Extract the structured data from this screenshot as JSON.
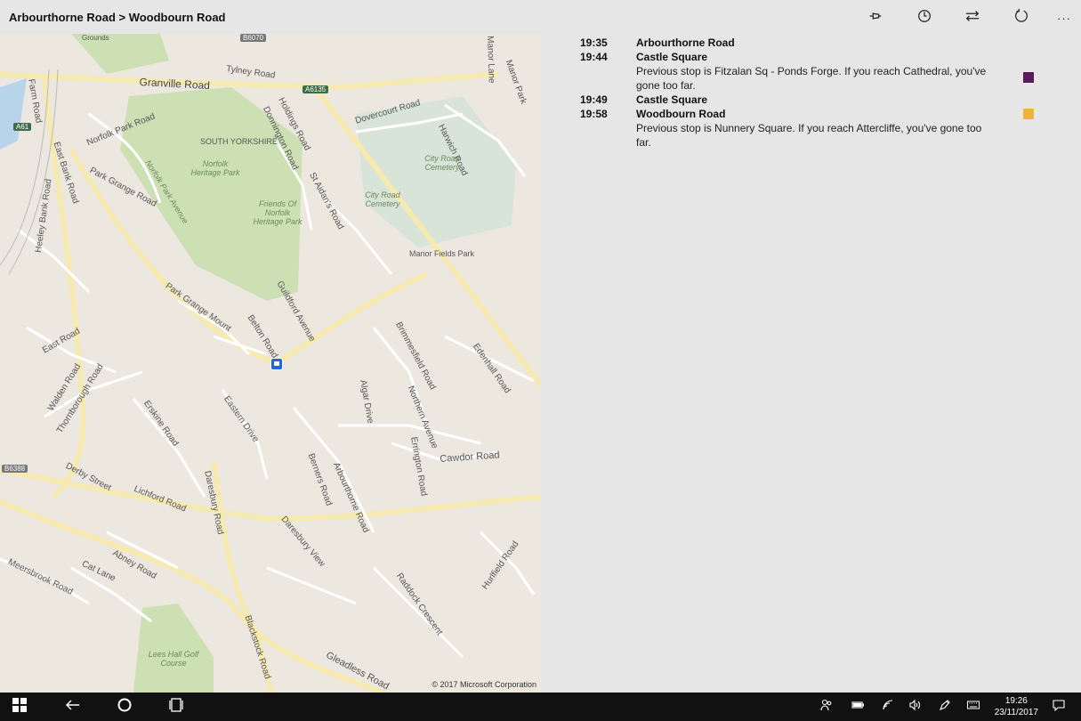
{
  "window": {
    "title": "Arbourthorne Road > Woodbourn Road"
  },
  "commands": [
    {
      "name": "pin-icon"
    },
    {
      "name": "clock-icon"
    },
    {
      "name": "swap-direction-icon"
    },
    {
      "name": "refresh-icon"
    },
    {
      "name": "more-icon",
      "label": "···"
    }
  ],
  "map": {
    "copyright": "© 2017 Microsoft Corporation",
    "labels": {
      "tylney": "Tylney Road",
      "granville": "Granville Road",
      "farm": "Farm Road",
      "norfolk_park_rd": "Norfolk Park Road",
      "east_bank": "East Bank Road",
      "park_grange_rd": "Park Grange Road",
      "south_yorkshire": "SOUTH YORKSHIRE",
      "norfolk_heritage": "Norfolk Heritage Park",
      "friends": "Friends Of Norfolk Heritage Park",
      "norfolk_park_ave": "Norfolk Park Avenue",
      "holdings": "Holdings Road",
      "donnington": "Donnington Road",
      "dovercourt": "Dovercourt Road",
      "harwich": "Harwich Road",
      "city_road_cem": "City Road Cemetery",
      "city_road_cem2": "City Road Cemetery",
      "st_aidans": "St Aidan's Road",
      "manor_fields": "Manor Fields Park",
      "manor_park": "Manor Park",
      "manor_lane": "Manor Lane",
      "heeley_bank": "Heeley Bank Road",
      "park_grange_mount": "Park Grange Mount",
      "guildford": "Guildford Avenue",
      "belton": "Belton Road",
      "brimmesfield": "Brimmesfield Road",
      "edenhall": "Edenhall Road",
      "east_road": "East Road",
      "walden": "Walden Road",
      "thornborough": "Thornborough Road",
      "erskine": "Erskine Road",
      "eastern_drive": "Eastern Drive",
      "algar": "Algar Drive",
      "northern_ave": "Northern Avenue",
      "errington": "Errington Road",
      "cawdor": "Cawdor Road",
      "derby": "Derby Street",
      "lichford": "Lichford Road",
      "daresbury": "Daresbury Road",
      "berners": "Berners Road",
      "arbourthorne": "Arbourthorne Road",
      "daresbury_view": "Daresbury View",
      "meersbrook": "Meersbrook Road",
      "cat_lane": "Cat Lane",
      "abney": "Abney Road",
      "hurlfield": "Hurlfield Road",
      "raddock": "Raddock Crescent",
      "blackstock": "Blackstock Road",
      "gleadless": "Gleadless Road",
      "lees_hall": "Lees Hall Golf Course",
      "grounds": "Grounds"
    },
    "shields": {
      "a61": "A61",
      "a6135": "A6135",
      "b6070": "B6070",
      "b6388": "B6388"
    },
    "bus_stop_icon": "bus-stop-icon"
  },
  "timetable": [
    {
      "time": "19:35",
      "stop": "Arbourthorne Road",
      "note": "",
      "color": ""
    },
    {
      "time": "19:44",
      "stop": "Castle Square",
      "note": "Previous stop is Fitzalan Sq - Ponds Forge. If you reach Cathedral, you've gone too far.",
      "color": "#5c1a5c"
    },
    {
      "time": "19:49",
      "stop": "Castle Square",
      "note": "",
      "color": ""
    },
    {
      "time": "19:58",
      "stop": "Woodbourn Road",
      "note": "Previous stop is Nunnery Square. If you reach Attercliffe, you've gone too far.",
      "color": "#f0b43c"
    }
  ],
  "taskbar": {
    "clock_time": "19:26",
    "clock_date": "23/11/2017"
  }
}
